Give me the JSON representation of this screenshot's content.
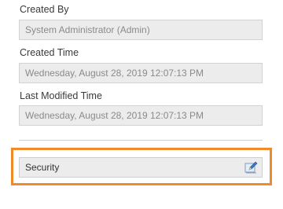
{
  "properties": {
    "created_by": {
      "label": "Created By",
      "value": "System Administrator (Admin)"
    },
    "created_time": {
      "label": "Created Time",
      "value": "Wednesday, August 28, 2019 12:07:13 PM"
    },
    "last_modified_time": {
      "label": "Last Modified Time",
      "value": "Wednesday, August 28, 2019 12:07:13 PM"
    }
  },
  "security": {
    "value": "Security",
    "edit_icon": "pencil-edit-icon"
  },
  "colors": {
    "highlight_border": "#f08a2a",
    "field_background": "#ececec",
    "icon_blue": "#3a78c8"
  }
}
